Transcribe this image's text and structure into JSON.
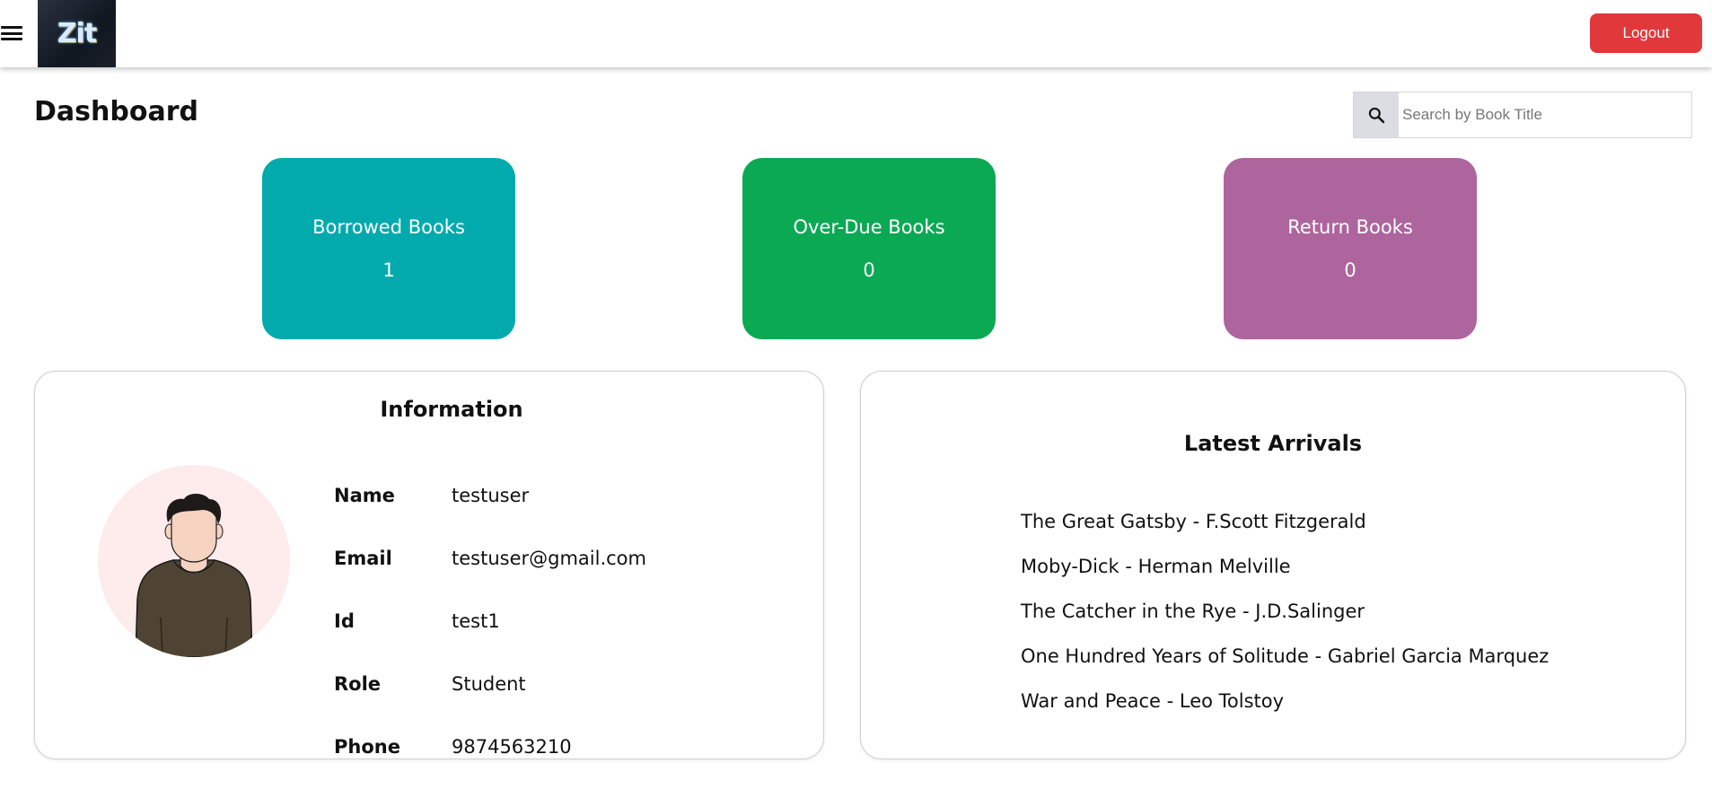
{
  "header": {
    "logo_text": "Zit",
    "logout_label": "Logout"
  },
  "page": {
    "title": "Dashboard"
  },
  "search": {
    "placeholder": "Search by Book Title",
    "value": ""
  },
  "stats": {
    "borrowed": {
      "label": "Borrowed Books",
      "value": "1",
      "color": "#02aaae"
    },
    "overdue": {
      "label": "Over-Due Books",
      "value": "0",
      "color": "#0ba953"
    },
    "returned": {
      "label": "Return Books",
      "value": "0",
      "color": "#ae649d"
    }
  },
  "information": {
    "title": "Information",
    "rows": [
      {
        "label": "Name",
        "value": "testuser"
      },
      {
        "label": "Email",
        "value": "testuser@gmail.com"
      },
      {
        "label": "Id",
        "value": "test1"
      },
      {
        "label": "Role",
        "value": "Student"
      },
      {
        "label": "Phone",
        "value": "9874563210"
      }
    ]
  },
  "latest_arrivals": {
    "title": "Latest Arrivals",
    "items": [
      "The Great Gatsby - F.Scott Fitzgerald",
      "Moby-Dick - Herman Melville",
      "The Catcher in the Rye - J.D.Salinger",
      "One Hundred Years of Solitude - Gabriel Garcia Marquez",
      "War and Peace - Leo Tolstoy"
    ]
  },
  "colors": {
    "logout": "#e0383b",
    "avatar_bg": "#fdeceb"
  }
}
